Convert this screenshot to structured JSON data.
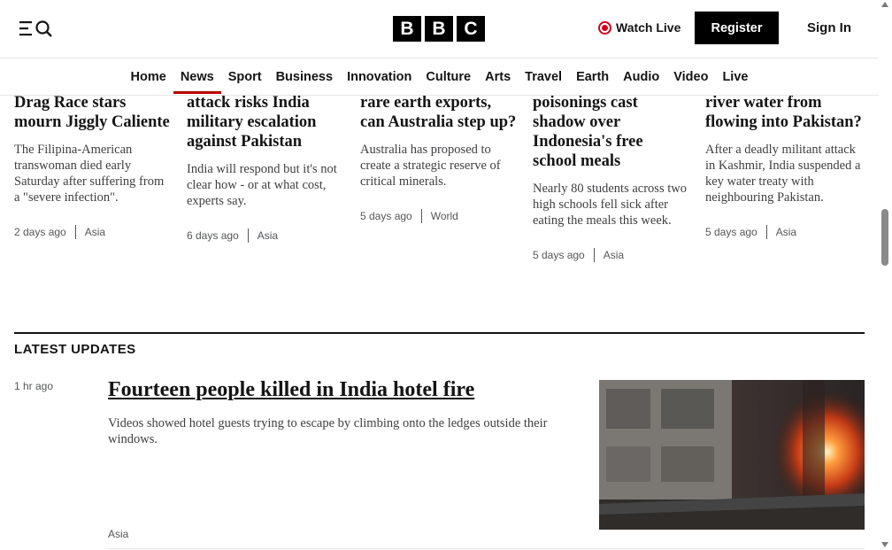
{
  "header": {
    "logo_letters": [
      "B",
      "B",
      "C"
    ],
    "watch_live": "Watch Live",
    "register": "Register",
    "sign_in": "Sign In",
    "menu_icon": "menu-icon",
    "search_icon": "search-icon",
    "live_color": "#d0011b"
  },
  "nav": {
    "items": [
      "Home",
      "News",
      "Sport",
      "Business",
      "Innovation",
      "Culture",
      "Arts",
      "Travel",
      "Earth",
      "Audio",
      "Video",
      "Live"
    ],
    "active": "News",
    "active_color": "#b80000"
  },
  "cards": [
    {
      "headline": "Drag Race stars mourn Jiggly Caliente",
      "summary": "The Filipina-American transwoman died early Saturday after suffering from a \"severe infection\".",
      "time": "2 days ago",
      "section": "Asia"
    },
    {
      "headline": "attack risks India military escalation against Pakistan",
      "summary": "India will respond but it's not clear how - or at what cost, experts say.",
      "time": "6 days ago",
      "section": "Asia"
    },
    {
      "headline": "rare earth exports, can Australia step up?",
      "summary": "Australia has proposed to create a strategic reserve of critical minerals.",
      "time": "5 days ago",
      "section": "World"
    },
    {
      "headline": "poisonings cast shadow over Indonesia's free school meals",
      "summary": "Nearly 80 students across two high schools fell sick after eating the meals this week.",
      "time": "5 days ago",
      "section": "Asia"
    },
    {
      "headline": "river water from flowing into Pakistan?",
      "summary": "After a deadly militant attack in Kashmir, India suspended a key water treaty with neighbouring Pakistan.",
      "time": "5 days ago",
      "section": "Asia"
    }
  ],
  "latest": {
    "label": "LATEST UPDATES",
    "time": "1 hr ago",
    "headline": "Fourteen people killed in India hotel fire",
    "summary": "Videos showed hotel guests trying to escape by climbing onto the ledges outside their windows.",
    "section": "Asia"
  }
}
